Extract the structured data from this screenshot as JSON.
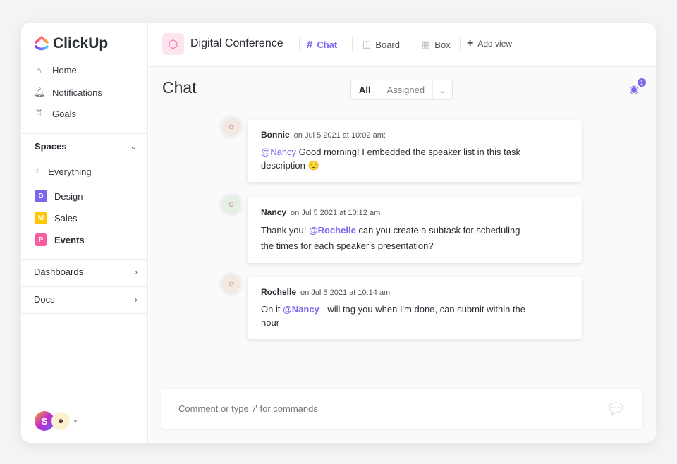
{
  "app": {
    "name": "ClickUp"
  },
  "sidebar": {
    "nav": [
      {
        "label": "Home",
        "icon": "home-icon"
      },
      {
        "label": "Notifications",
        "icon": "bell-icon"
      },
      {
        "label": "Goals",
        "icon": "trophy-icon"
      }
    ],
    "spaces_label": "Spaces",
    "everything": "Everything",
    "spaces": [
      {
        "letter": "D",
        "label": "Design",
        "color": "#7b68ee"
      },
      {
        "letter": "M",
        "label": "Sales",
        "color": "#ffc800"
      },
      {
        "letter": "P",
        "label": "Events",
        "color": "#f55fa0"
      }
    ],
    "dashboards": "Dashboards",
    "docs": "Docs",
    "user_initial": "S"
  },
  "header": {
    "title": "Digital Conference",
    "tabs": [
      {
        "label": "Chat"
      },
      {
        "label": "Board"
      },
      {
        "label": "Box"
      },
      {
        "label": "Add view"
      }
    ]
  },
  "chat": {
    "title": "Chat",
    "filter": {
      "all": "All",
      "assigned": "Assigned"
    },
    "watchers": "1",
    "messages": [
      {
        "author": "Bonnie",
        "time": "on Jul 5 2021 at 10:02 am:",
        "mention": "@Nancy",
        "pre": "",
        "text": " Good morning! I embedded the speaker list in this task description 🙂"
      },
      {
        "author": "Nancy",
        "time": "on Jul 5 2021 at 10:12 am",
        "pre": "Thank you! ",
        "mention": "@Rochelle",
        "text": " can you create a subtask for scheduling the times for each speaker's presentation?"
      },
      {
        "author": "Rochelle",
        "time": "on Jul 5 2021 at 10:14 am",
        "pre": "On it ",
        "mention": "@Nancy",
        "text": " - will tag you when I'm done, can submit within the hour"
      }
    ],
    "comment_placeholder": "Comment or type '/' for commands"
  }
}
